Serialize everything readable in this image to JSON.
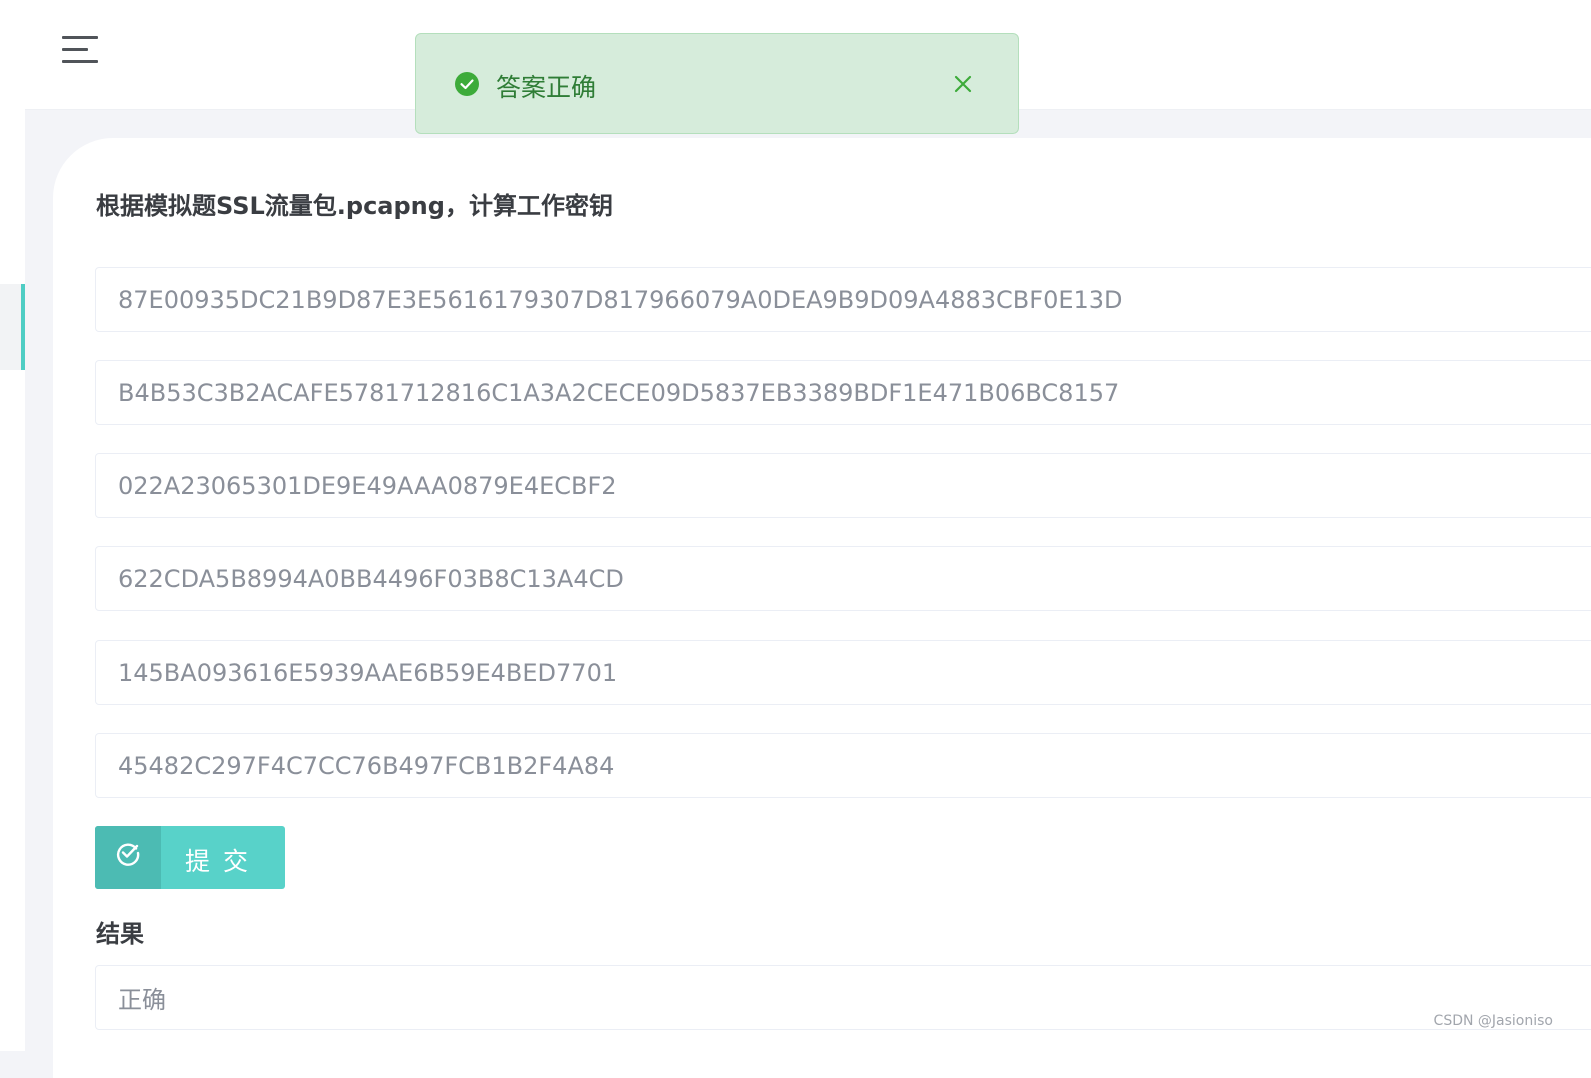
{
  "toast": {
    "message": "答案正确",
    "icon": "check-circle-icon",
    "close_icon": "close-icon",
    "color": "#2f7d36"
  },
  "question": {
    "title": "根据模拟题SSL流量包.pcapng，计算工作密钥"
  },
  "fields": [
    "87E00935DC21B9D87E3E5616179307D817966079A0DEA9B9D09A4883CBF0E13D",
    "B4B53C3B2ACAFE5781712816C1A3A2CECE09D5837EB3389BDF1E471B06BC8157",
    "022A23065301DE9E49AAA0879E4ECBF2",
    "622CDA5B8994A0BB4496F03B8C13A4CD",
    "145BA093616E5939AAE6B59E4BED7701",
    "45482C297F4C7CC76B497FCB1B2F4A84"
  ],
  "submit": {
    "label": "提交",
    "icon": "check-circle-outline-icon",
    "color": "#58d2c9"
  },
  "result": {
    "label": "结果",
    "value": "正确"
  },
  "watermark": "CSDN @Jasioniso",
  "accent_color": "#4ecdc4"
}
